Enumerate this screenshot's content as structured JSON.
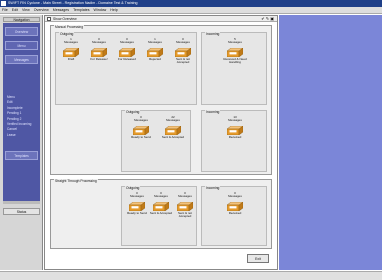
{
  "window": {
    "title": "SWIFT FIN Cyclone - Main Street - Registration Nadim - Domaine Test & Training"
  },
  "menu": [
    "File",
    "Edit",
    "View",
    "Overview",
    "Messages",
    "Templates",
    "Window",
    "Help"
  ],
  "nav": {
    "header": "Navigation",
    "buttons": [
      "Overview",
      "Menu",
      "Messages"
    ],
    "items": [
      "Menu",
      "Edit",
      "Incomplete",
      "Pending 1",
      "Pending 2",
      "Verified Incoming",
      "Cancel",
      "Lease"
    ],
    "extra": "Templates",
    "status": "Status"
  },
  "toolbar": {
    "checkbox_label": "Show Overview"
  },
  "manual": {
    "title": "Manual Processing",
    "outgoing": {
      "title": "Outgoing",
      "cols": [
        {
          "n": "1",
          "u": "Messages",
          "s": "Draft"
        },
        {
          "n": "0",
          "u": "Messages",
          "s": "For Release!"
        },
        {
          "n": "0",
          "u": "Messages",
          "s": "For Release2"
        },
        {
          "n": "1",
          "u": "Messages",
          "s": "Rejected"
        },
        {
          "n": "0",
          "u": "Messages",
          "s": "Sent & not Accepted"
        }
      ]
    },
    "incoming": {
      "title": "Incoming",
      "cols": [
        {
          "n": "5",
          "u": "Messages",
          "s": "Received & Need Handling"
        }
      ]
    },
    "outgoing2": {
      "title": "Outgoing",
      "cols": [
        {
          "n": "0",
          "u": "Messages",
          "s": "Ready to Send"
        },
        {
          "n": "22",
          "u": "Messages",
          "s": "Sent & Accepted"
        }
      ]
    },
    "incoming2": {
      "title": "Incoming",
      "cols": [
        {
          "n": "13",
          "u": "Messages",
          "s": "Received"
        }
      ]
    }
  },
  "stp": {
    "title": "Straight Through Processing",
    "outgoing": {
      "title": "Outgoing",
      "cols": [
        {
          "n": "0",
          "u": "Messages",
          "s": "Ready to Send"
        },
        {
          "n": "0",
          "u": "Messages",
          "s": "Sent & Accepted"
        },
        {
          "n": "0",
          "u": "Messages",
          "s": "Sent & not Accepted"
        }
      ]
    },
    "incoming": {
      "title": "Incoming",
      "cols": [
        {
          "n": "0",
          "u": "Messages",
          "s": "Received"
        }
      ]
    }
  },
  "exit_label": "Exit",
  "colors": {
    "nav": "#4f57a4",
    "side": "#7b86d8",
    "tray": "#e59a2a"
  }
}
